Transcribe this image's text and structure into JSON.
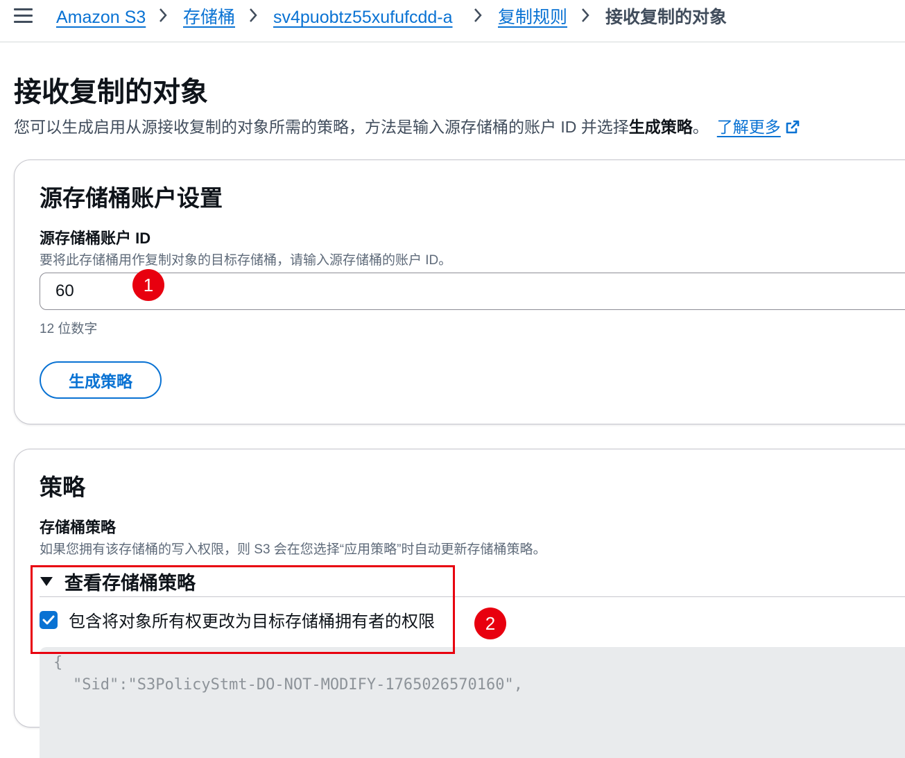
{
  "breadcrumb": {
    "items": [
      "Amazon S3",
      "存储桶",
      "sv4puobtz55xufufcdd-a",
      "复制规则"
    ],
    "current": "接收复制的对象"
  },
  "page": {
    "title": "接收复制的对象",
    "description": "您可以生成启用从源接收复制的对象所需的策略，方法是输入源存储桶的账户 ID 并选择",
    "description_bold": "生成策略",
    "description_end": "。",
    "learn_more": "了解更多"
  },
  "source_account": {
    "title": "源存储桶账户设置",
    "field_label": "源存储桶账户 ID",
    "field_description": "要将此存储桶用作复制对象的目标存储桶，请输入源存储桶的账户 ID。",
    "field_value": "60",
    "constraint": "12 位数字",
    "generate_button": "生成策略"
  },
  "policy": {
    "title": "策略",
    "label": "存储桶策略",
    "description": "如果您拥有该存储桶的写入权限，则 S3 会在您选择“应用策略”时自动更新存储桶策略。",
    "expand_label": "查看存储桶策略",
    "checkbox_label": "包含将对象所有权更改为目标存储桶拥有者的权限",
    "checkbox_checked": true,
    "code_line1": "{",
    "code_line2": "\"Sid\":\"S3PolicyStmt-DO-NOT-MODIFY-1765026570160\","
  },
  "annotations": {
    "marker1": "1",
    "marker2": "2",
    "color": "#e8000f"
  },
  "colors": {
    "link": "#0972d3",
    "text": "#0f141a",
    "secondary_text": "#5f6b7a",
    "code_background": "#e9ebed"
  },
  "icons": [
    "menu-icon",
    "chevron-right-icon",
    "external-link-icon",
    "caret-down-icon",
    "checkmark-icon"
  ]
}
